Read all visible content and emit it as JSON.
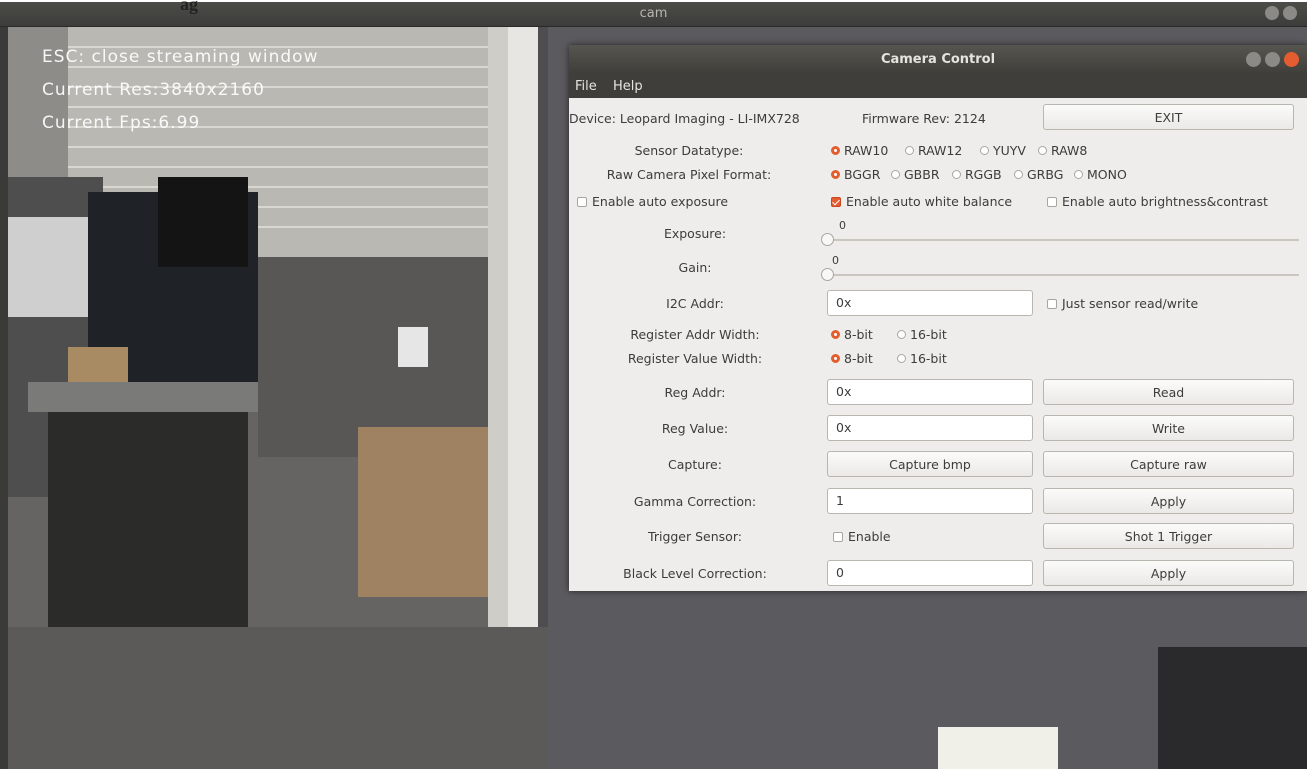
{
  "caption_fragment": "ag",
  "cam_window": {
    "title": "cam"
  },
  "overlay": {
    "line1": "ESC: close streaming window",
    "line2": "Current Res:3840x2160",
    "line3": "Current Fps:6.99"
  },
  "control": {
    "title": "Camera Control",
    "menu": {
      "file": "File",
      "help": "Help"
    },
    "device": "Device: Leopard Imaging - LI-IMX728",
    "firmware": "Firmware Rev: 2124",
    "exit_label": "EXIT",
    "sensor_datatype": {
      "label": "Sensor Datatype:",
      "options": [
        "RAW10",
        "RAW12",
        "YUYV",
        "RAW8"
      ],
      "selected": "RAW10"
    },
    "pixel_format": {
      "label": "Raw Camera Pixel Format:",
      "options": [
        "BGGR",
        "GBBR",
        "RGGB",
        "GRBG",
        "MONO"
      ],
      "selected": "BGGR"
    },
    "checks": {
      "auto_exposure": {
        "label": "Enable auto exposure",
        "checked": false
      },
      "auto_white_balance": {
        "label": "Enable auto white balance",
        "checked": true
      },
      "auto_brightness": {
        "label": "Enable auto brightness&contrast",
        "checked": false
      }
    },
    "exposure": {
      "label": "Exposure:",
      "value": "0"
    },
    "gain": {
      "label": "Gain:",
      "value": "0"
    },
    "i2c": {
      "label": "I2C Addr:",
      "value": "0x",
      "just_sensor_label": "Just sensor read/write"
    },
    "reg_addr_width": {
      "label": "Register Addr Width:",
      "options": [
        "8-bit",
        "16-bit"
      ],
      "selected": "8-bit"
    },
    "reg_value_width": {
      "label": "Register Value Width:",
      "options": [
        "8-bit",
        "16-bit"
      ],
      "selected": "8-bit"
    },
    "reg_addr": {
      "label": "Reg Addr:",
      "value": "0x",
      "button": "Read"
    },
    "reg_value": {
      "label": "Reg Value:",
      "value": "0x",
      "button": "Write"
    },
    "capture": {
      "label": "Capture:",
      "bmp_button": "Capture bmp",
      "raw_button": "Capture raw"
    },
    "gamma": {
      "label": "Gamma Correction:",
      "value": "1",
      "button": "Apply"
    },
    "trigger": {
      "label": "Trigger Sensor:",
      "enable_label": "Enable",
      "button": "Shot 1 Trigger"
    },
    "black_level": {
      "label": "Black Level Correction:",
      "value": "0",
      "button": "Apply"
    }
  },
  "colors": {
    "accent": "#e35d30",
    "titlebar": "#3f3e3a",
    "panel": "#efedeb"
  }
}
